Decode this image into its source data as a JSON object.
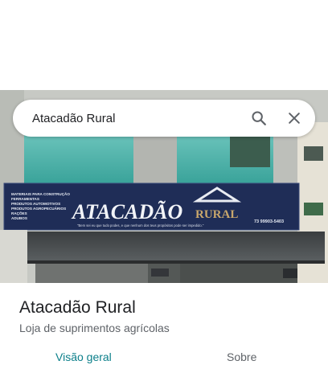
{
  "search": {
    "query": "Atacadão Rural"
  },
  "photo": {
    "storefront_sign": {
      "name": "ATACADÃO",
      "name_suffix": "RURAL",
      "left_lines": [
        "MATERIAIS PARA CONSTRUÇÃO",
        "FERRAMENTAS",
        "PRODUTOS AUTOMOTIVOS",
        "PRODUTOS AGROPECUÁRIOS",
        "RAÇÕES",
        "ADUBOS"
      ],
      "slogan": "\"Bem sei eu que tudo podes, e que nenhum dos teus propósitos pode ser impedido.\"",
      "phone": "73 99903-5403"
    }
  },
  "place": {
    "title": "Atacadão Rural",
    "category": "Loja de suprimentos agrícolas"
  },
  "tabs": [
    {
      "label": "Visão geral",
      "active": true
    },
    {
      "label": "Sobre",
      "active": false
    }
  ],
  "colors": {
    "accent": "#0b7f8a",
    "sign_bg": "#1f2d57"
  }
}
